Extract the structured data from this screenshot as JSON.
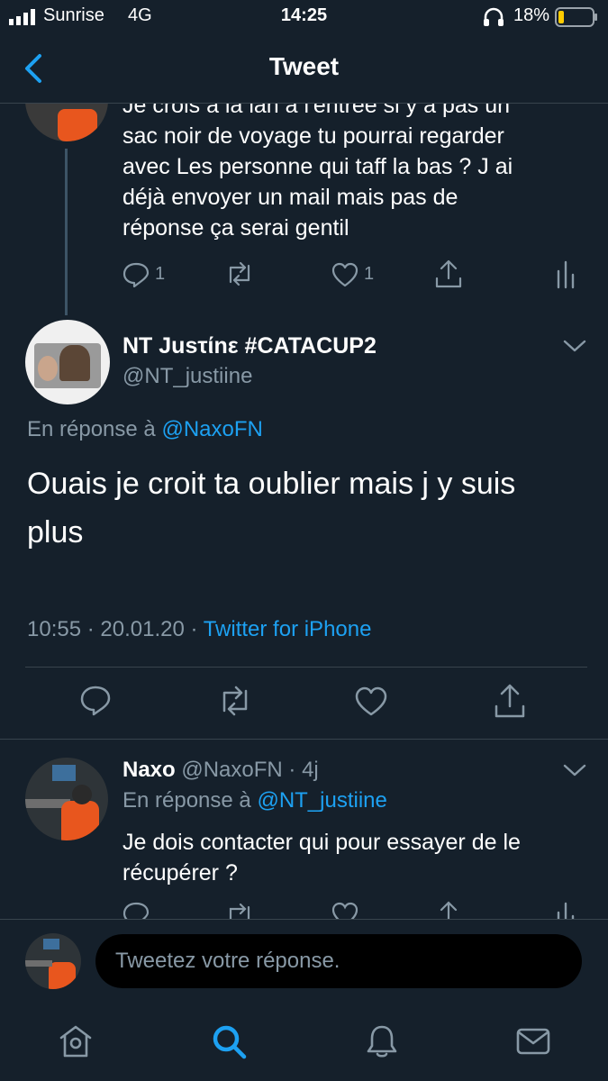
{
  "status_bar": {
    "carrier": "Sunrise",
    "network": "4G",
    "time": "14:25",
    "battery_percent": "18%",
    "battery_level": 0.18
  },
  "nav": {
    "title": "Tweet",
    "back_icon": "chevron-left-icon"
  },
  "parent_tweet": {
    "text_lines": [
      "Je crois à la lan à l'entrée si y a pas un",
      "sac noir de voyage tu pourrai regarder",
      "avec Les personne qui taff la bas ? J ai",
      "déjà envoyer un mail mais pas de",
      "réponse ça serai gentil"
    ],
    "reply_count": "1",
    "like_count": "1"
  },
  "main_tweet": {
    "display_name": "NT Jusτίnε #CATACUP2",
    "handle": "@NT_justiine",
    "reply_prefix": "En réponse à",
    "reply_to": "@NaxoFN",
    "text_lines": [
      "Ouais je croit ta oublier mais j y suis",
      "plus"
    ],
    "timestamp": "10:55 · 20.01.20 · ",
    "source": "Twitter for iPhone"
  },
  "reply_tweet": {
    "display_name": "Naxo",
    "handle_meta": "@NaxoFN · 4j",
    "reply_prefix": "En réponse à",
    "reply_to": "@NT_justiine",
    "text_lines": [
      "Je dois contacter qui pour essayer de le",
      "récupérer ?"
    ]
  },
  "compose": {
    "placeholder": "Tweetez votre réponse."
  },
  "tab_bar": {
    "items": [
      "home-icon",
      "search-icon",
      "notifications-icon",
      "messages-icon"
    ],
    "active": "search-icon"
  },
  "colors": {
    "background": "#15202b",
    "accent": "#1da1f2",
    "muted": "#8899a6",
    "divider": "#38444d",
    "battery": "#ffcc00"
  }
}
